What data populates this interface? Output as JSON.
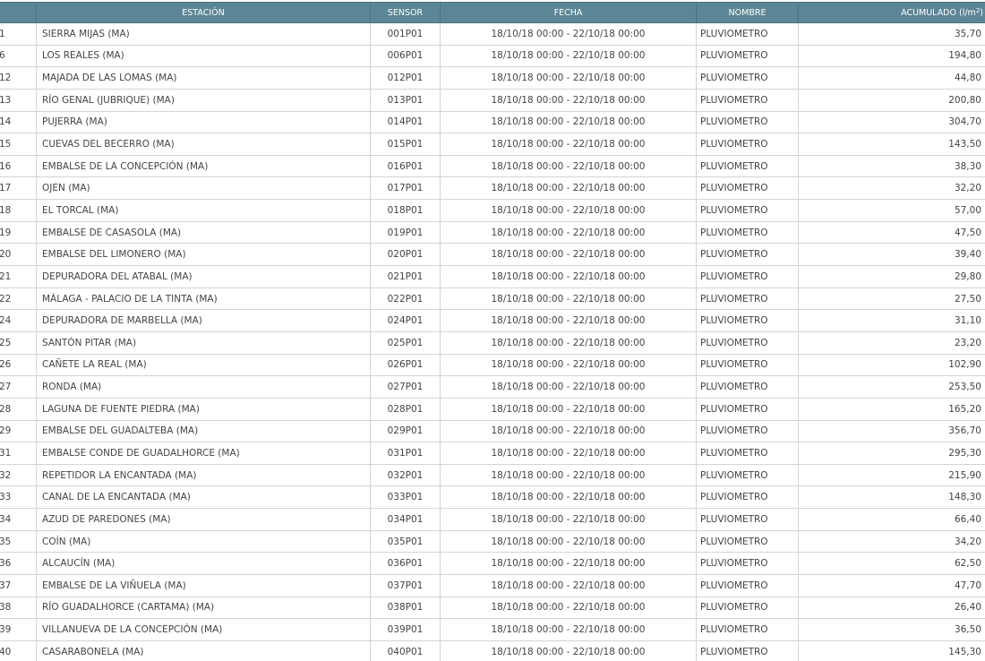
{
  "header": {
    "id": "",
    "estacion": "ESTACIÓN",
    "sensor": "SENSOR",
    "fecha": "FECHA",
    "nombre": "NOMBRE",
    "acumulado": "ACUMULADO (l/m",
    "acumulado_sup": "2",
    "acumulado_close": ")"
  },
  "rows": [
    {
      "id": "1",
      "estacion": "SIERRA MIJAS (MA)",
      "sensor": "001P01",
      "fecha": "18/10/18 00:00 - 22/10/18 00:00",
      "nombre": "PLUVIOMETRO",
      "acumulado": "35,70"
    },
    {
      "id": "6",
      "estacion": "LOS REALES (MA)",
      "sensor": "006P01",
      "fecha": "18/10/18 00:00 - 22/10/18 00:00",
      "nombre": "PLUVIOMETRO",
      "acumulado": "194,80"
    },
    {
      "id": "12",
      "estacion": "MAJADA DE LAS LOMAS (MA)",
      "sensor": "012P01",
      "fecha": "18/10/18 00:00 - 22/10/18 00:00",
      "nombre": "PLUVIOMETRO",
      "acumulado": "44,80"
    },
    {
      "id": "13",
      "estacion": "RÍO GENAL (JUBRIQUE) (MA)",
      "sensor": "013P01",
      "fecha": "18/10/18 00:00 - 22/10/18 00:00",
      "nombre": "PLUVIOMETRO",
      "acumulado": "200,80"
    },
    {
      "id": "14",
      "estacion": "PUJERRA (MA)",
      "sensor": "014P01",
      "fecha": "18/10/18 00:00 - 22/10/18 00:00",
      "nombre": "PLUVIOMETRO",
      "acumulado": "304,70"
    },
    {
      "id": "15",
      "estacion": "CUEVAS DEL BECERRO (MA)",
      "sensor": "015P01",
      "fecha": "18/10/18 00:00 - 22/10/18 00:00",
      "nombre": "PLUVIOMETRO",
      "acumulado": "143,50"
    },
    {
      "id": "16",
      "estacion": "EMBALSE DE LA CONCEPCIÓN (MA)",
      "sensor": "016P01",
      "fecha": "18/10/18 00:00 - 22/10/18 00:00",
      "nombre": "PLUVIOMETRO",
      "acumulado": "38,30"
    },
    {
      "id": "17",
      "estacion": "OJEN (MA)",
      "sensor": "017P01",
      "fecha": "18/10/18 00:00 - 22/10/18 00:00",
      "nombre": "PLUVIOMETRO",
      "acumulado": "32,20"
    },
    {
      "id": "18",
      "estacion": "EL TORCAL (MA)",
      "sensor": "018P01",
      "fecha": "18/10/18 00:00 - 22/10/18 00:00",
      "nombre": "PLUVIOMETRO",
      "acumulado": "57,00"
    },
    {
      "id": "19",
      "estacion": "EMBALSE DE CASASOLA (MA)",
      "sensor": "019P01",
      "fecha": "18/10/18 00:00 - 22/10/18 00:00",
      "nombre": "PLUVIOMETRO",
      "acumulado": "47,50"
    },
    {
      "id": "20",
      "estacion": "EMBALSE DEL LIMONERO (MA)",
      "sensor": "020P01",
      "fecha": "18/10/18 00:00 - 22/10/18 00:00",
      "nombre": "PLUVIOMETRO",
      "acumulado": "39,40"
    },
    {
      "id": "21",
      "estacion": "DEPURADORA DEL ATABAL (MA)",
      "sensor": "021P01",
      "fecha": "18/10/18 00:00 - 22/10/18 00:00",
      "nombre": "PLUVIOMETRO",
      "acumulado": "29,80"
    },
    {
      "id": "22",
      "estacion": "MÁLAGA - PALACIO DE LA TINTA (MA)",
      "sensor": "022P01",
      "fecha": "18/10/18 00:00 - 22/10/18 00:00",
      "nombre": "PLUVIOMETRO",
      "acumulado": "27,50"
    },
    {
      "id": "24",
      "estacion": "DEPURADORA DE MARBELLA (MA)",
      "sensor": "024P01",
      "fecha": "18/10/18 00:00 - 22/10/18 00:00",
      "nombre": "PLUVIOMETRO",
      "acumulado": "31,10"
    },
    {
      "id": "25",
      "estacion": "SANTÓN PITAR (MA)",
      "sensor": "025P01",
      "fecha": "18/10/18 00:00 - 22/10/18 00:00",
      "nombre": "PLUVIOMETRO",
      "acumulado": "23,20"
    },
    {
      "id": "26",
      "estacion": "CAÑETE LA REAL (MA)",
      "sensor": "026P01",
      "fecha": "18/10/18 00:00 - 22/10/18 00:00",
      "nombre": "PLUVIOMETRO",
      "acumulado": "102,90"
    },
    {
      "id": "27",
      "estacion": "RONDA (MA)",
      "sensor": "027P01",
      "fecha": "18/10/18 00:00 - 22/10/18 00:00",
      "nombre": "PLUVIOMETRO",
      "acumulado": "253,50"
    },
    {
      "id": "28",
      "estacion": "LAGUNA DE FUENTE PIEDRA (MA)",
      "sensor": "028P01",
      "fecha": "18/10/18 00:00 - 22/10/18 00:00",
      "nombre": "PLUVIOMETRO",
      "acumulado": "165,20"
    },
    {
      "id": "29",
      "estacion": "EMBALSE DEL GUADALTEBA (MA)",
      "sensor": "029P01",
      "fecha": "18/10/18 00:00 - 22/10/18 00:00",
      "nombre": "PLUVIOMETRO",
      "acumulado": "356,70"
    },
    {
      "id": "31",
      "estacion": "EMBALSE CONDE DE GUADALHORCE (MA)",
      "sensor": "031P01",
      "fecha": "18/10/18 00:00 - 22/10/18 00:00",
      "nombre": "PLUVIOMETRO",
      "acumulado": "295,30"
    },
    {
      "id": "32",
      "estacion": "REPETIDOR LA ENCANTADA (MA)",
      "sensor": "032P01",
      "fecha": "18/10/18 00:00 - 22/10/18 00:00",
      "nombre": "PLUVIOMETRO",
      "acumulado": "215,90"
    },
    {
      "id": "33",
      "estacion": "CANAL DE LA ENCANTADA (MA)",
      "sensor": "033P01",
      "fecha": "18/10/18 00:00 - 22/10/18 00:00",
      "nombre": "PLUVIOMETRO",
      "acumulado": "148,30"
    },
    {
      "id": "34",
      "estacion": "AZUD DE PAREDONES (MA)",
      "sensor": "034P01",
      "fecha": "18/10/18 00:00 - 22/10/18 00:00",
      "nombre": "PLUVIOMETRO",
      "acumulado": "66,40"
    },
    {
      "id": "35",
      "estacion": "COÍN (MA)",
      "sensor": "035P01",
      "fecha": "18/10/18 00:00 - 22/10/18 00:00",
      "nombre": "PLUVIOMETRO",
      "acumulado": "34,20"
    },
    {
      "id": "36",
      "estacion": "ALCAUCÍN (MA)",
      "sensor": "036P01",
      "fecha": "18/10/18 00:00 - 22/10/18 00:00",
      "nombre": "PLUVIOMETRO",
      "acumulado": "62,50"
    },
    {
      "id": "37",
      "estacion": "EMBALSE DE LA VIÑUELA (MA)",
      "sensor": "037P01",
      "fecha": "18/10/18 00:00 - 22/10/18 00:00",
      "nombre": "PLUVIOMETRO",
      "acumulado": "47,70"
    },
    {
      "id": "38",
      "estacion": "RÍO GUADALHORCE (CARTAMA) (MA)",
      "sensor": "038P01",
      "fecha": "18/10/18 00:00 - 22/10/18 00:00",
      "nombre": "PLUVIOMETRO",
      "acumulado": "26,40"
    },
    {
      "id": "39",
      "estacion": "VILLANUEVA DE LA CONCEPCIÓN (MA)",
      "sensor": "039P01",
      "fecha": "18/10/18 00:00 - 22/10/18 00:00",
      "nombre": "PLUVIOMETRO",
      "acumulado": "36,50"
    },
    {
      "id": "40",
      "estacion": "CASARABONELA (MA)",
      "sensor": "040P01",
      "fecha": "18/10/18 00:00 - 22/10/18 00:00",
      "nombre": "PLUVIOMETRO",
      "acumulado": "145,30"
    }
  ],
  "colors": {
    "header_bg": "#5c8696",
    "header_text": "#ffffff",
    "border": "#d4d4d4",
    "text": "#444444"
  }
}
